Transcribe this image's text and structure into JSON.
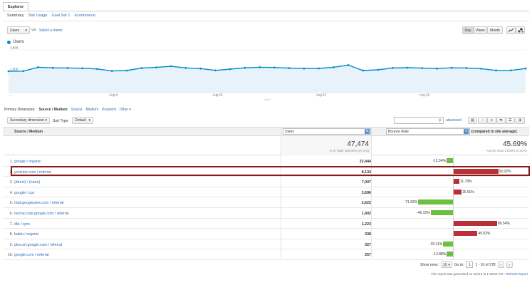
{
  "explorer_tab": "Explorer",
  "subtabs": [
    "Summary",
    "Site Usage",
    "Goal Set 1",
    "Ecommerce"
  ],
  "metric_select": "Users",
  "vs_label": "VS",
  "select_metric_link": "Select a metric",
  "time_buttons": [
    "Day",
    "Week",
    "Month"
  ],
  "chart_legend": "Users",
  "chart_data": {
    "type": "area",
    "title": "",
    "series": [
      {
        "name": "Users",
        "values": [
          1500,
          1510,
          1780,
          1740,
          1730,
          1710,
          1660,
          1520,
          1550,
          1720,
          1770,
          1850,
          1730,
          1690,
          1560,
          1650,
          1740,
          1780,
          1760,
          1720,
          1690,
          1700,
          1780,
          1930,
          1550,
          1600,
          1730,
          1750,
          1720,
          1690,
          1740,
          1730,
          1680,
          1560,
          1560,
          1690
        ]
      }
    ],
    "x_tick_labels": [
      "...",
      "Aug 8",
      "Aug 15",
      "Aug 22",
      "Aug 29"
    ],
    "y_ticks": [
      "3,000",
      "1,500"
    ],
    "ylim": [
      0,
      3000
    ],
    "color": "#058dc7"
  },
  "primary_dimension": {
    "label": "Primary Dimension:",
    "active": "Source / Medium",
    "options": [
      "Source",
      "Medium",
      "Keyword",
      "Other ▾"
    ]
  },
  "secondary_dimension": "Secondary dimension",
  "sort_type_label": "Sort Type:",
  "sort_type_value": "Default",
  "search_link": "advanced",
  "table": {
    "col_source": "Source / Medium",
    "col_users": "Users",
    "col_bounce": "Bounce Rate",
    "compared_label": "(compared to site average)",
    "total_users": "47,474",
    "total_users_sub": "% of Total: 100.00% (47,474)",
    "bounce_avg": "45.69%",
    "bounce_avg_sub": "Avg for View: 45.69% (0.00%)",
    "rows": [
      {
        "n": "1.",
        "source": "google / organic",
        "users": "22,444",
        "label": "-13.34%",
        "pct": -13.34
      },
      {
        "n": "2.",
        "source": "youtube.com / referral",
        "users": "8,134",
        "label": "92.02%",
        "pct": 92.02
      },
      {
        "n": "3.",
        "source": "(direct) / (none)",
        "users": "7,007",
        "label": "11.79%",
        "pct": 11.79
      },
      {
        "n": "4.",
        "source": "google / cpc",
        "users": "3,696",
        "label": "15.91%",
        "pct": 15.91
      },
      {
        "n": "5.",
        "source": "mail.googleplex.com / referral",
        "users": "2,622",
        "label": "-71.92%",
        "pct": -71.92
      },
      {
        "n": "6.",
        "source": "moma.corp.google.com / referral",
        "users": "1,402",
        "label": "-46.15%",
        "pct": -46.15
      },
      {
        "n": "7.",
        "source": "dfa / cpm",
        "users": "1,223",
        "label": "89.54%",
        "pct": 89.54
      },
      {
        "n": "8.",
        "source": "baidu / organic",
        "users": "338",
        "label": "49.02%",
        "pct": 49.02
      },
      {
        "n": "9.",
        "source": "plus.url.google.com / referral",
        "users": "327",
        "label": "-20.11%",
        "pct": -20.11
      },
      {
        "n": "10.",
        "source": "google.com / referral",
        "users": "257",
        "label": "-12.88%",
        "pct": -12.88
      }
    ]
  },
  "pagination": {
    "show_rows_label": "Show rows:",
    "show_rows_value": "10",
    "goto_label": "Go to:",
    "goto_value": "1",
    "range": "1 - 10 of 278"
  },
  "footer_note": "This report was generated on 3/2/16 at 1:28:54 PM -",
  "refresh_link": "Refresh Report"
}
